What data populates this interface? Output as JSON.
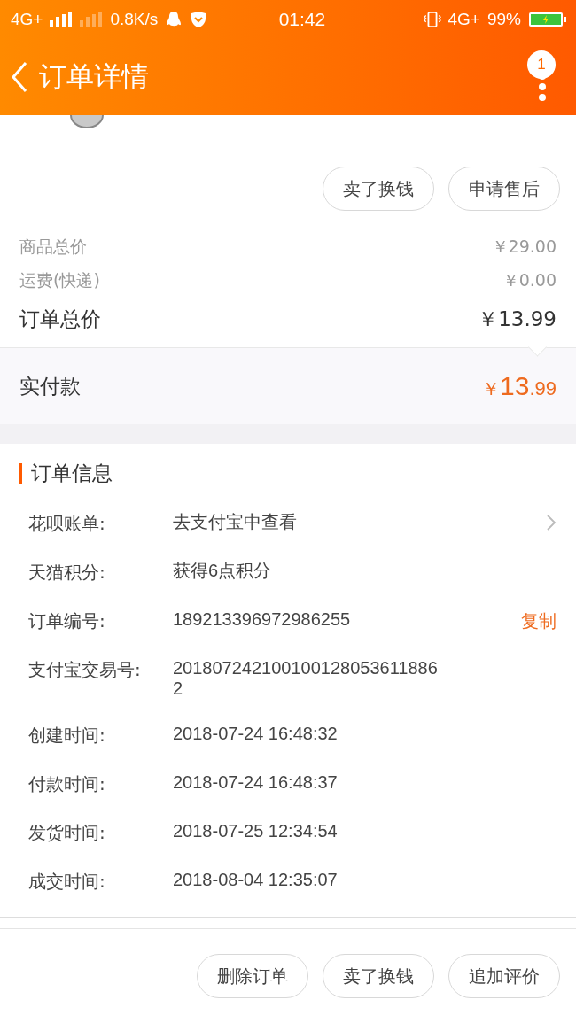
{
  "status_bar": {
    "network_left": "4G+",
    "speed": "0.8K/s",
    "time": "01:42",
    "network_right": "4G+",
    "battery": "99%"
  },
  "header": {
    "title": "订单详情",
    "badge": "1"
  },
  "top_actions": [
    "卖了换钱",
    "申请售后"
  ],
  "prices": [
    {
      "label": "商品总价",
      "value": "￥29.00",
      "kind": "minor"
    },
    {
      "label": "运费(快递)",
      "value": "￥0.00",
      "kind": "minor"
    },
    {
      "label": "订单总价",
      "value": "￥13.99",
      "kind": "major"
    }
  ],
  "paid": {
    "label": "实付款",
    "currency": "￥",
    "integer": "13",
    "decimal": ".99"
  },
  "order_info": {
    "title": "订单信息",
    "rows": [
      {
        "label": "花呗账单:",
        "value": "去支付宝中查看",
        "kind": "link"
      },
      {
        "label": "天猫积分:",
        "value": "获得6点积分",
        "kind": "plain"
      },
      {
        "label": "订单编号:",
        "value": "189213396972986255",
        "kind": "copy",
        "action": "复制"
      },
      {
        "label": "支付宝交易号:",
        "value": "2018072421001001280536118862",
        "kind": "plain"
      },
      {
        "label": "创建时间:",
        "value": "2018-07-24 16:48:32",
        "kind": "plain"
      },
      {
        "label": "付款时间:",
        "value": "2018-07-24 16:48:37",
        "kind": "plain"
      },
      {
        "label": "发货时间:",
        "value": "2018-07-25 12:34:54",
        "kind": "plain"
      },
      {
        "label": "成交时间:",
        "value": "2018-08-04 12:35:07",
        "kind": "plain"
      }
    ]
  },
  "bottom_actions": [
    "删除订单",
    "卖了换钱",
    "追加评价"
  ]
}
